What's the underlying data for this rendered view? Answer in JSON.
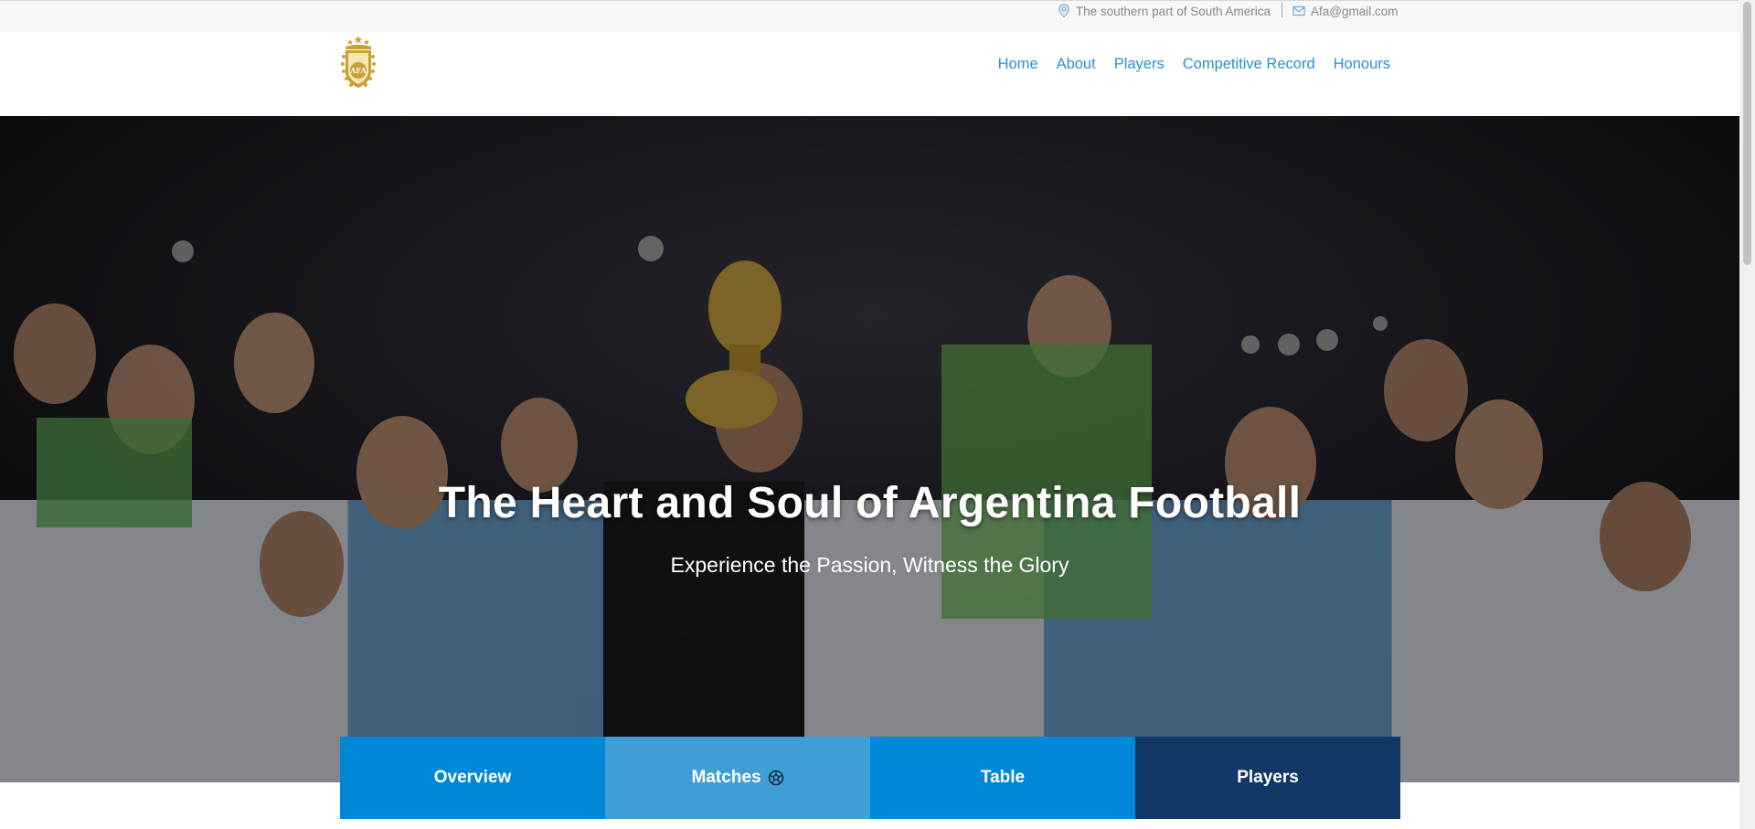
{
  "topbar": {
    "location_text": "The southern part of South America",
    "location_icon": "location-pin-icon",
    "email_text": "Afa@gmail.com",
    "email_icon": "envelope-icon"
  },
  "header": {
    "logo_icon": "afa-crest-logo",
    "logo_text": "AFA",
    "nav": [
      {
        "label": "Home"
      },
      {
        "label": "About"
      },
      {
        "label": "Players"
      },
      {
        "label": "Competitive Record"
      },
      {
        "label": "Honours"
      }
    ]
  },
  "hero": {
    "title": "The Heart and Soul of Argentina Football",
    "subtitle": "Experience the Passion, Witness the Glory"
  },
  "tabs": [
    {
      "label": "Overview",
      "color": "#0088d8"
    },
    {
      "label": "Matches",
      "color": "#3f9ed6",
      "icon": "soccer-ball-icon"
    },
    {
      "label": "Table",
      "color": "#0088d8"
    },
    {
      "label": "Players",
      "color": "#103766"
    }
  ],
  "colors": {
    "nav_link": "#2b8fd4",
    "topbar_bg": "#f7f7f7",
    "logo_gold": "#c8a033"
  }
}
